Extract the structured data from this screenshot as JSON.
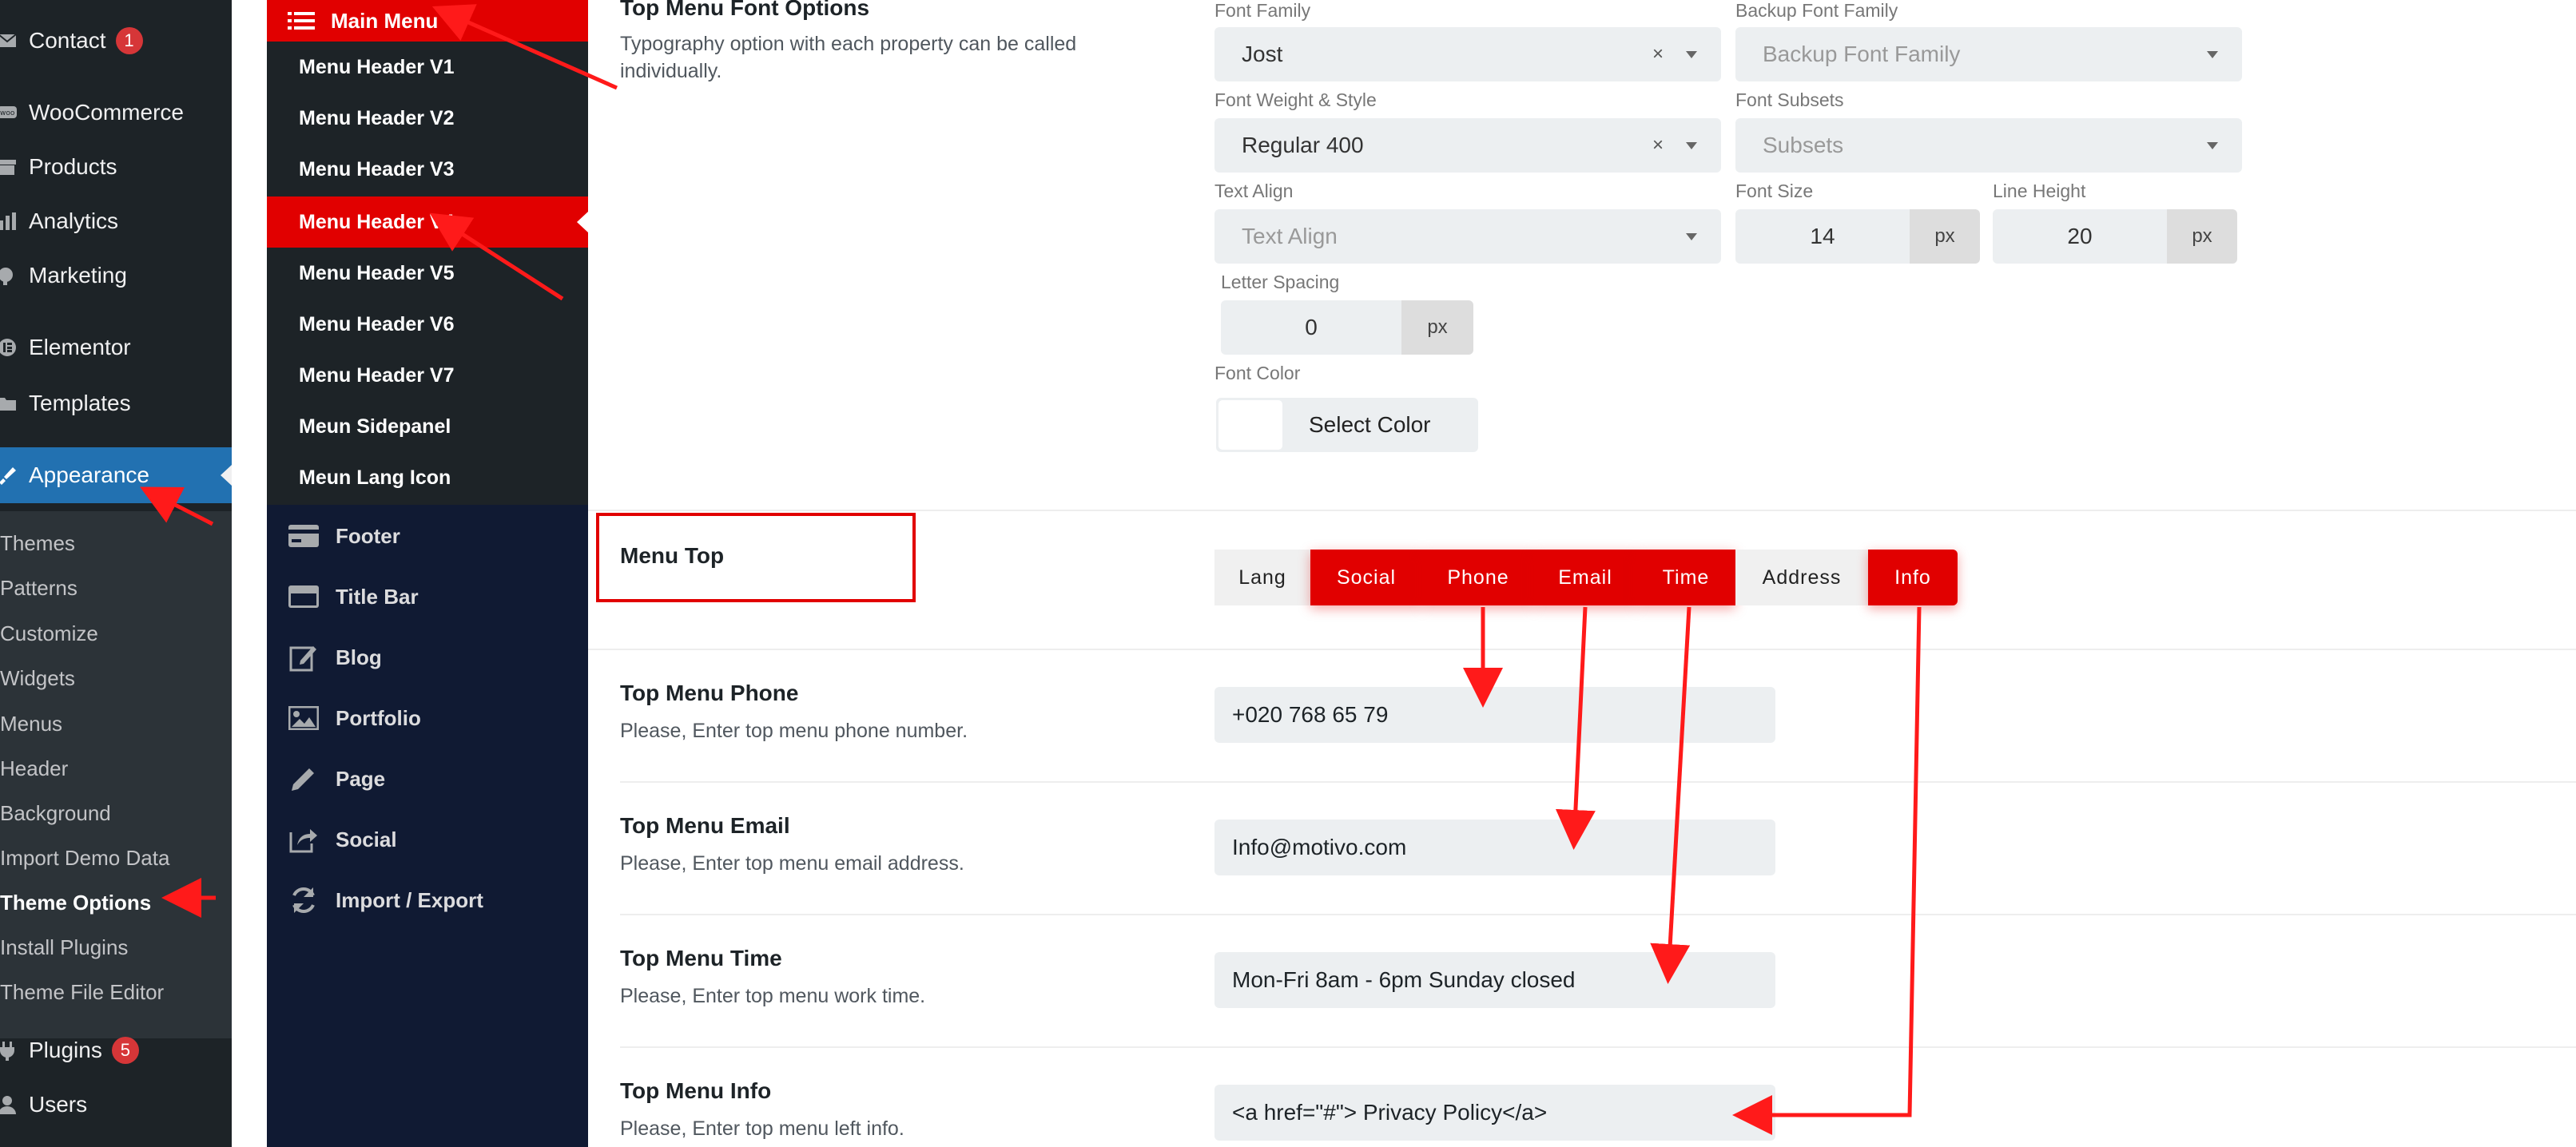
{
  "wp_sidebar": {
    "items": [
      {
        "label": "Contact",
        "icon": "mail-icon",
        "badge": "1"
      },
      {
        "label": "WooCommerce",
        "icon": "woo-icon"
      },
      {
        "label": "Products",
        "icon": "archive-icon"
      },
      {
        "label": "Analytics",
        "icon": "chart-icon"
      },
      {
        "label": "Marketing",
        "icon": "megaphone-icon"
      },
      {
        "label": "Elementor",
        "icon": "elementor-icon"
      },
      {
        "label": "Templates",
        "icon": "folder-icon"
      },
      {
        "label": "Appearance",
        "icon": "brush-icon"
      },
      {
        "label": "Plugins",
        "icon": "plug-icon",
        "badge": "5"
      },
      {
        "label": "Users",
        "icon": "user-icon"
      }
    ],
    "appearance_sub": [
      "Themes",
      "Patterns",
      "Customize",
      "Widgets",
      "Menus",
      "Header",
      "Background",
      "Import Demo Data",
      "Theme Options",
      "Install Plugins",
      "Theme File Editor"
    ]
  },
  "redux_menu": {
    "main": "Main Menu",
    "subs": [
      "Menu Header V1",
      "Menu Header V2",
      "Menu Header V3",
      "Menu Header V4",
      "Menu Header V5",
      "Menu Header V6",
      "Menu Header V7",
      "Meun Sidepanel",
      "Meun Lang Icon"
    ],
    "items": [
      {
        "label": "Footer",
        "icon": "card-icon"
      },
      {
        "label": "Title Bar",
        "icon": "titlebar-icon"
      },
      {
        "label": "Blog",
        "icon": "edit-icon"
      },
      {
        "label": "Portfolio",
        "icon": "image-icon"
      },
      {
        "label": "Page",
        "icon": "pencil-icon"
      },
      {
        "label": "Social",
        "icon": "share-icon"
      },
      {
        "label": "Import / Export",
        "icon": "refresh-icon"
      }
    ]
  },
  "font_options": {
    "title": "Top Menu Font Options",
    "desc": "Typography option with each property can be called individually.",
    "font_family_label": "Font Family",
    "font_family": "Jost",
    "backup_font_label": "Backup Font Family",
    "backup_font_placeholder": "Backup Font Family",
    "weight_label": "Font Weight & Style",
    "weight": "Regular 400",
    "subsets_label": "Font Subsets",
    "subsets_placeholder": "Subsets",
    "align_label": "Text Align",
    "align_placeholder": "Text Align",
    "size_label": "Font Size",
    "size": "14",
    "line_height_label": "Line Height",
    "line_height": "20",
    "letter_label": "Letter Spacing",
    "letter": "0",
    "unit": "px",
    "color_label": "Font Color",
    "color_button": "Select Color",
    "clear_glyph": "×"
  },
  "menu_top": {
    "title": "Menu Top",
    "buttons": [
      {
        "label": "Lang",
        "active": false
      },
      {
        "label": "Social",
        "active": true
      },
      {
        "label": "Phone",
        "active": true
      },
      {
        "label": "Email",
        "active": true
      },
      {
        "label": "Time",
        "active": true
      },
      {
        "label": "Address",
        "active": false
      },
      {
        "label": "Info",
        "active": true
      }
    ]
  },
  "fields": [
    {
      "title": "Top Menu Phone",
      "desc": "Please, Enter top menu phone number.",
      "value": "+020 768 65 79"
    },
    {
      "title": "Top Menu Email",
      "desc": "Please, Enter top menu email address.",
      "value": "Info@motivo.com"
    },
    {
      "title": "Top Menu Time",
      "desc": "Please, Enter top menu work time.",
      "value": "Mon-Fri 8am - 6pm Sunday closed"
    },
    {
      "title": "Top Menu Info",
      "desc": "Please, Enter top menu left info.",
      "value": "<a href=\"#\"> Privacy Policy</a>"
    }
  ],
  "colors": {
    "accent": "#e10000",
    "wp_dark": "#1d2327",
    "wp_blue": "#2271b1",
    "panel_navy": "#101a33",
    "annotation": "#ff1a1a"
  }
}
